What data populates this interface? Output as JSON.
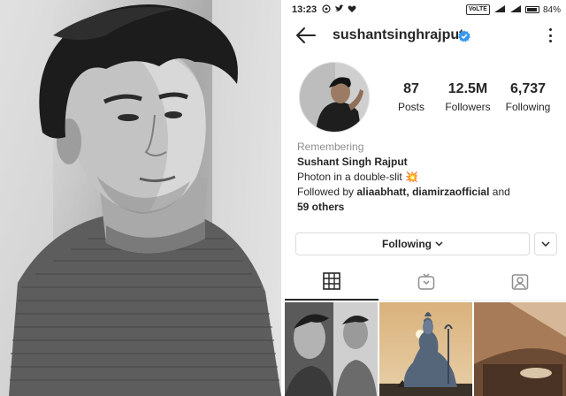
{
  "status_bar": {
    "time": "13:23",
    "left_icons": [
      "whatsapp-icon",
      "twitter-icon",
      "heart-icon"
    ],
    "network_label": "VoLTE",
    "battery": "84%"
  },
  "profile": {
    "username": "sushantsinghrajput",
    "verified": true,
    "stats": [
      {
        "value": "87",
        "label": "Posts"
      },
      {
        "value": "12.5M",
        "label": "Followers"
      },
      {
        "value": "6,737",
        "label": "Following"
      }
    ],
    "bio": {
      "memorial": "Remembering",
      "full_name": "Sushant Singh Rajput",
      "tagline": "Photon in a double-slit",
      "tagline_emoji": "💥",
      "followed_by_prefix": "Followed by",
      "followed_by_users": [
        "aliaabhatt",
        "diamirzaofficial"
      ],
      "followed_by_connector": "and",
      "followed_by_others": "59 others"
    }
  },
  "actions": {
    "following_label": "Following"
  },
  "tabs": [
    "grid-icon",
    "igtv-icon",
    "tagged-icon"
  ],
  "colors": {
    "text": "#262626",
    "muted": "#8e8e8e",
    "verified": "#3897f0",
    "border": "#dbdbdb"
  }
}
